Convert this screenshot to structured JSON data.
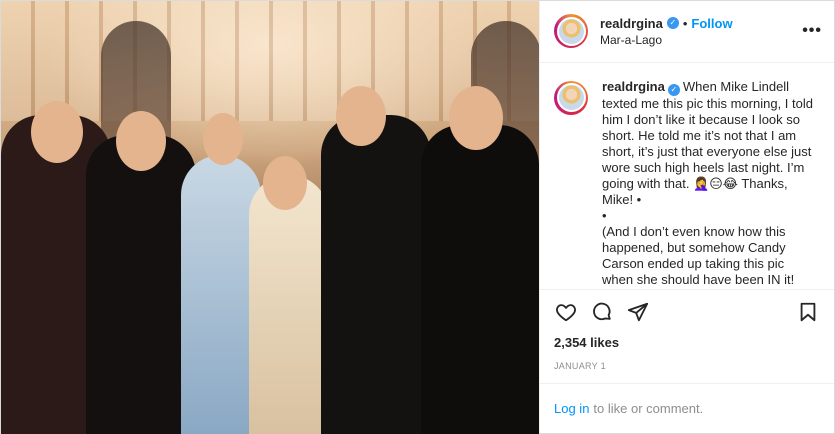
{
  "header": {
    "username": "realdrgina",
    "separator": "•",
    "follow_label": "Follow",
    "location": "Mar-a-Lago",
    "more_label": "•••"
  },
  "caption": {
    "username": "realdrgina",
    "line1": "When Mike Lindell texted me this pic this morning, I told him I don’t like it because I look so short. He told me it’s not that I am short, it’s just that everyone else just wore such high heels last night. I’m going with that. 🤦‍♀️😑😂 Thanks, Mike! •",
    "line2": "•",
    "line3": "(And I don’t even know how this happened, but somehow Candy Carson ended up taking this pic when she should have been IN it! She did a"
  },
  "actions": {
    "icons": [
      "heart-icon",
      "comment-icon",
      "share-icon",
      "bookmark-icon"
    ],
    "likes": "2,354 likes",
    "date": "JANUARY 1"
  },
  "login": {
    "link_label": "Log in",
    "rest_text": "to like or comment."
  },
  "colors": {
    "accent_blue": "#0095f6",
    "verified_blue": "#3897f0",
    "muted_text": "#8e8e8e",
    "divider": "#efefef"
  }
}
